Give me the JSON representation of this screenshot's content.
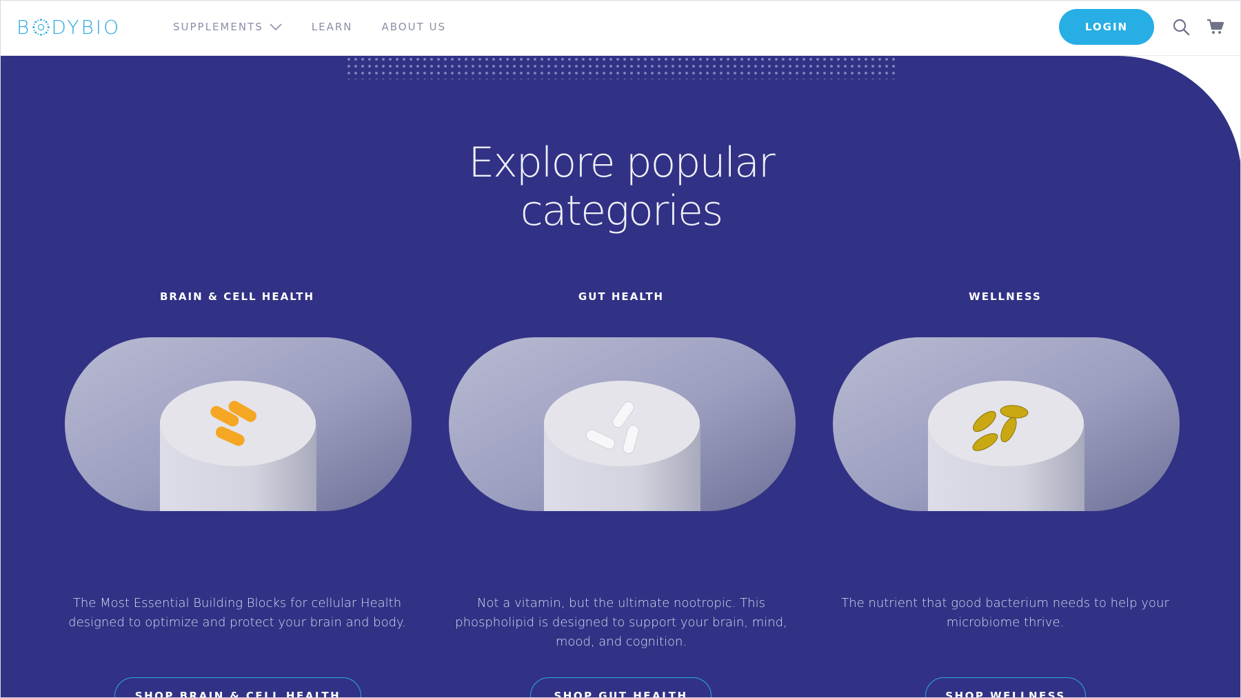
{
  "brand": {
    "logo_text_prefix": "B",
    "logo_text_suffix": "DYBIO",
    "accent_color": "#2aa8e0",
    "section_bg_color": "#313285"
  },
  "header": {
    "nav": [
      {
        "label": "SUPPLEMENTS",
        "has_dropdown": true
      },
      {
        "label": "LEARN"
      },
      {
        "label": "ABOUT US"
      }
    ],
    "login_label": "LOGIN",
    "icons": [
      "search-icon",
      "cart-icon"
    ]
  },
  "main": {
    "heading_line1": "Explore popular",
    "heading_line2": "categories",
    "categories": [
      {
        "title": "BRAIN & CELL HEALTH",
        "description": "The Most Essential Building Blocks for cellular Health designed to optimize and protect your brain and body.",
        "button_label": "SHOP BRAIN & CELL HEALTH",
        "pill_color": "#f5a623"
      },
      {
        "title": "GUT HEALTH",
        "description": "Not a vitamin, but the ultimate nootropic. This phospholipid is designed to support your brain, mind, mood, and cognition.",
        "button_label": "SHOP GUT HEALTH",
        "pill_color": "#f4f4f6"
      },
      {
        "title": "WELLNESS",
        "description": "The nutrient that good bacterium needs to help your microbiome thrive.",
        "button_label": "SHOP WELLNESS",
        "pill_color": "#c9a814"
      }
    ]
  }
}
